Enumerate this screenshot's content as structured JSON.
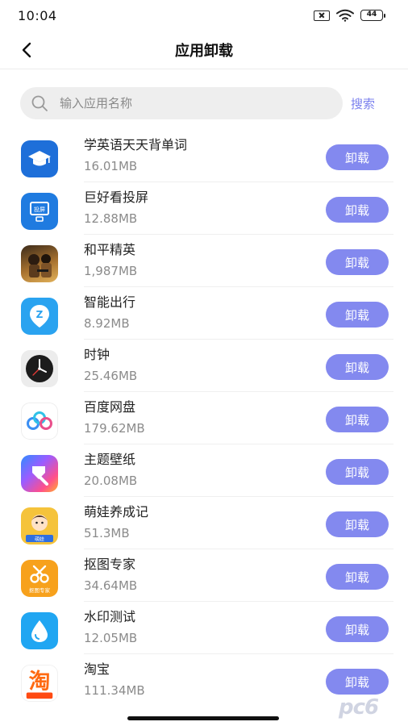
{
  "status_bar": {
    "time": "10:04",
    "battery": "44"
  },
  "header": {
    "title": "应用卸载"
  },
  "search": {
    "placeholder": "输入应用名称",
    "value": "",
    "button_label": "搜索"
  },
  "apps": [
    {
      "name": "学英语天天背单词",
      "size": "16.01MB",
      "uninstall_label": "卸载",
      "icon": "graduation-cap-icon",
      "color": "#1e6fd9"
    },
    {
      "name": "巨好看投屏",
      "size": "12.88MB",
      "uninstall_label": "卸载",
      "icon": "screen-cast-icon",
      "color": "#1f7be0"
    },
    {
      "name": "和平精英",
      "size": "1,987MB",
      "uninstall_label": "卸载",
      "icon": "game-icon",
      "color": "#8a5a2b"
    },
    {
      "name": "智能出行",
      "size": "8.92MB",
      "uninstall_label": "卸载",
      "icon": "map-pin-icon",
      "color": "#2aa3f0"
    },
    {
      "name": "时钟",
      "size": "25.46MB",
      "uninstall_label": "卸载",
      "icon": "clock-icon",
      "color": "#e9e9e9"
    },
    {
      "name": "百度网盘",
      "size": "179.62MB",
      "uninstall_label": "卸载",
      "icon": "cloud-drive-icon",
      "color": "#ffffff"
    },
    {
      "name": "主题壁纸",
      "size": "20.08MB",
      "uninstall_label": "卸载",
      "icon": "paint-brush-icon",
      "color": "#ff5b8a"
    },
    {
      "name": "萌娃养成记",
      "size": "51.3MB",
      "uninstall_label": "卸载",
      "icon": "baby-icon",
      "color": "#f5c33b"
    },
    {
      "name": "抠图专家",
      "size": "34.64MB",
      "uninstall_label": "卸载",
      "icon": "scissors-icon",
      "color": "#f7a11c"
    },
    {
      "name": "水印测试",
      "size": "12.05MB",
      "uninstall_label": "卸载",
      "icon": "water-drop-icon",
      "color": "#20a6f2"
    },
    {
      "name": "淘宝",
      "size": "111.34MB",
      "uninstall_label": "卸载",
      "icon": "taobao-icon",
      "color": "#ff6a12"
    }
  ],
  "icon_text": {
    "screen_cast": "投屏",
    "scissors": "抠图专家",
    "taobao": "淘",
    "baby": "萌娃"
  },
  "watermark": "pc6"
}
